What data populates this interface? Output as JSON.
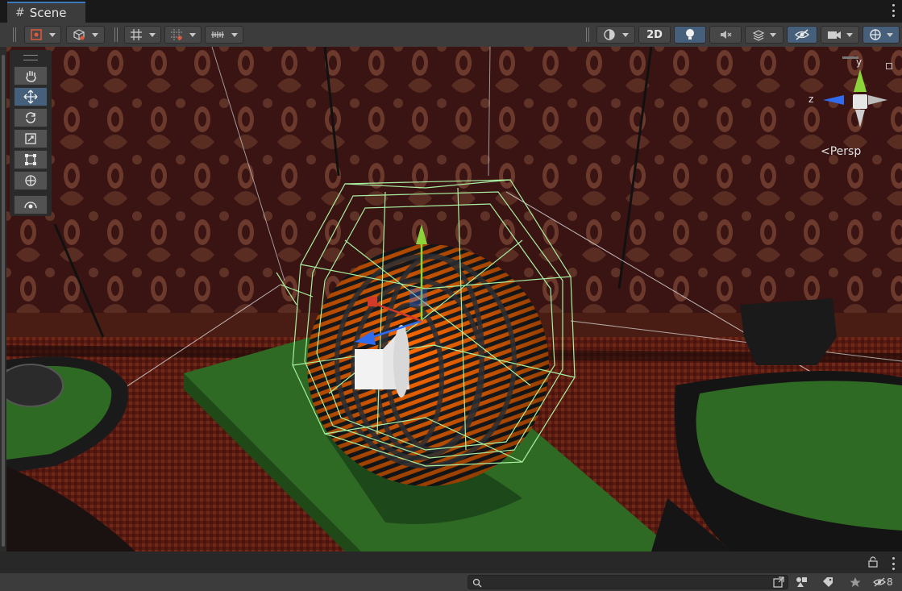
{
  "tab": {
    "title": "Scene",
    "glyph": "#"
  },
  "toolbar": {
    "btn_2d_label": "2D"
  },
  "gizmo": {
    "y_label": "y",
    "z_label": "z",
    "projection_label": "Persp"
  },
  "statusbar": {
    "search_placeholder": "",
    "hidden_count": "8"
  },
  "tools": [
    {
      "name": "hand-tool",
      "icon": "hand-icon"
    },
    {
      "name": "move-tool",
      "icon": "move-icon",
      "active": true
    },
    {
      "name": "rotate-tool",
      "icon": "rotate-icon"
    },
    {
      "name": "scale-tool",
      "icon": "scale-icon"
    },
    {
      "name": "rect-tool",
      "icon": "rect-transform-icon"
    },
    {
      "name": "transform-tool",
      "icon": "transform-icon"
    },
    {
      "name": "custom-tool",
      "icon": "custom-tool-icon"
    }
  ],
  "colors": {
    "accent": "#46607c",
    "tab_highlight": "#3a79bb",
    "table_felt": "#2f6a24",
    "wireframe": "#a8f0a0",
    "sphere_orange": "#ff6a00",
    "gizmo_y": "#8cd43c",
    "gizmo_z": "#2f6cf0"
  }
}
